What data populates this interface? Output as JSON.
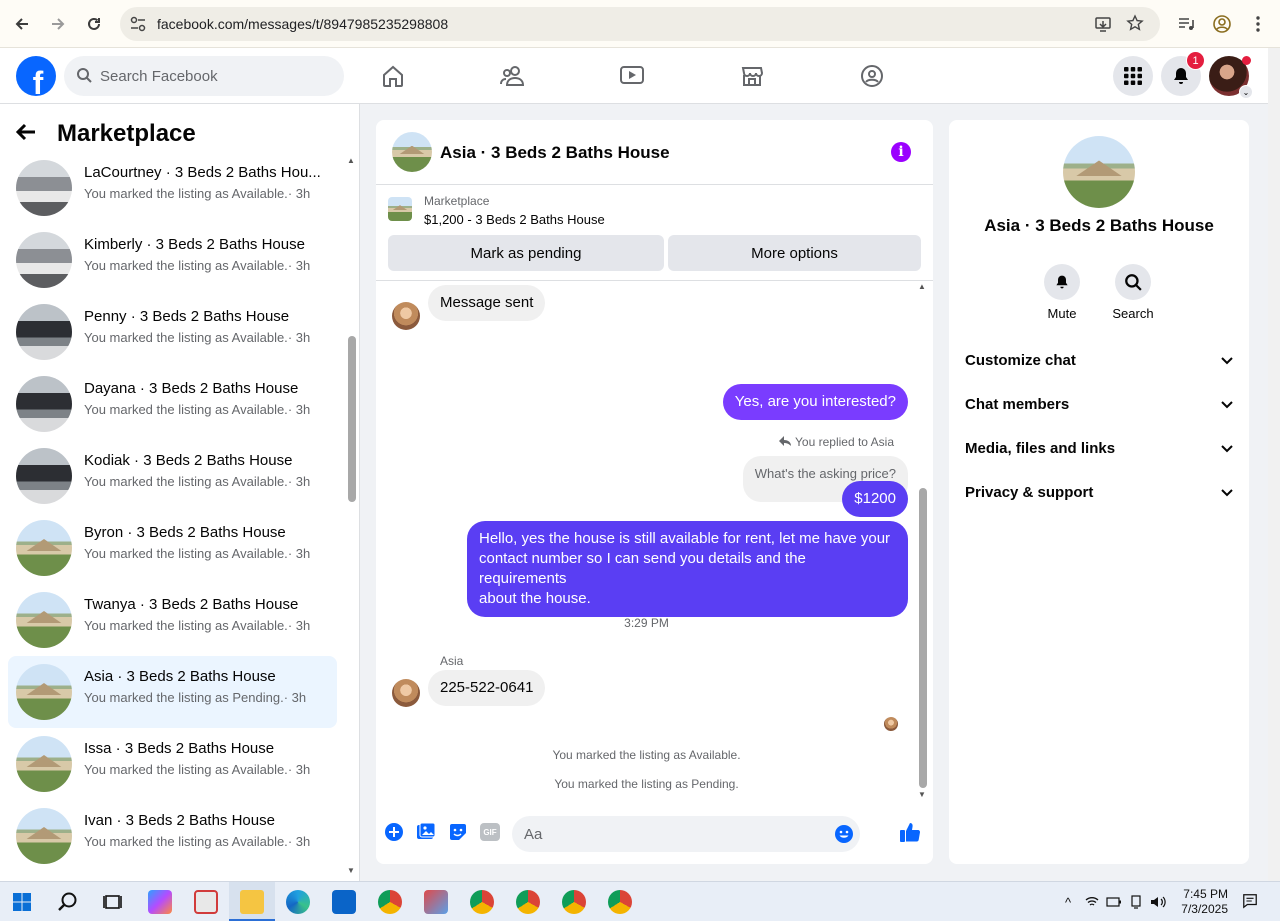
{
  "browser": {
    "url": "facebook.com/messages/t/8947985235298808"
  },
  "fb": {
    "search_placeholder": "Search Facebook",
    "notification_count": "1"
  },
  "left": {
    "title": "Marketplace",
    "conversations": [
      {
        "name": "LaCourtney · 3 Beds 2 Baths Hou...",
        "status": "You marked the listing as Available.",
        "time": "· 3h"
      },
      {
        "name": "Kimberly · 3 Beds 2 Baths House",
        "status": "You marked the listing as Available.",
        "time": "· 3h"
      },
      {
        "name": "Penny · 3 Beds 2 Baths House",
        "status": "You marked the listing as Available.",
        "time": "· 3h"
      },
      {
        "name": "Dayana · 3 Beds 2 Baths House",
        "status": "You marked the listing as Available.",
        "time": "· 3h"
      },
      {
        "name": "Kodiak · 3 Beds 2 Baths House",
        "status": "You marked the listing as Available.",
        "time": "· 3h"
      },
      {
        "name": "Byron · 3 Beds 2 Baths House",
        "status": "You marked the listing as Available.",
        "time": "· 3h"
      },
      {
        "name": "Twanya · 3 Beds 2 Baths House",
        "status": "You marked the listing as Available.",
        "time": "· 3h"
      },
      {
        "name": "Asia · 3 Beds 2 Baths House",
        "status": "You marked the listing as Pending.",
        "time": "· 3h"
      },
      {
        "name": "Issa · 3 Beds 2 Baths House",
        "status": "You marked the listing as Available.",
        "time": "· 3h"
      },
      {
        "name": "Ivan · 3 Beds 2 Baths House",
        "status": "You marked the listing as Available.",
        "time": "· 3h"
      }
    ]
  },
  "chat": {
    "title": "Asia · 3 Beds 2 Baths House",
    "marketplace_label": "Marketplace",
    "listing": "$1,200 - 3 Beds 2 Baths House",
    "mark_pending": "Mark as pending",
    "more_options": "More options",
    "messages": {
      "m1": "Message sent",
      "m2": "Yes, are you interested?",
      "reply_note": "You replied to Asia",
      "quoted": "What's the asking price?",
      "m3": "$1200",
      "m4_l1": "Hello, yes the house is still available for rent, let me have your",
      "m4_l2": "contact number so I can send you details and the requirements",
      "m4_l3": "about the house.",
      "timestamp": "3:29 PM",
      "sender": "Asia",
      "m5": "225-522-0641",
      "sys1": "You marked the listing as Available.",
      "sys2": "You marked the listing as Pending."
    },
    "composer_placeholder": "Aa",
    "gif_label": "GIF"
  },
  "right": {
    "title": "Asia · 3 Beds 2 Baths House",
    "mute": "Mute",
    "search": "Search",
    "sections": [
      "Customize chat",
      "Chat members",
      "Media, files and links",
      "Privacy & support"
    ]
  },
  "taskbar": {
    "time": "7:45 PM",
    "date": "7/3/2025"
  },
  "colors": {
    "fb_blue": "#0866ff",
    "outgoing_bubble": "#7a3cff",
    "info_purple": "#9b00ff",
    "active_conversation": "#ebf5ff"
  }
}
